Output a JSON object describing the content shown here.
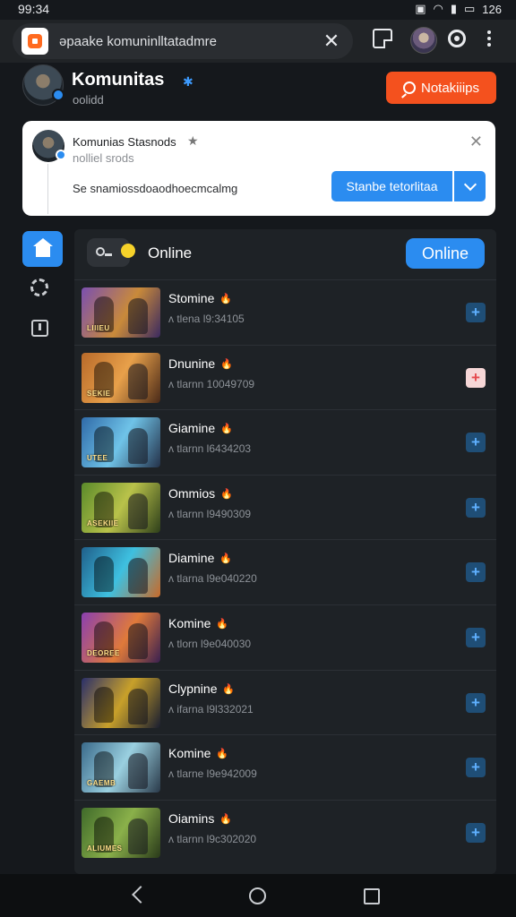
{
  "status_bar": {
    "time": "99:34",
    "battery": "126"
  },
  "browser": {
    "url": "əpaake komuninlltatadmre"
  },
  "community": {
    "title": "Komunitas",
    "subtitle": "oolidd",
    "notify_label": "Notakiiips",
    "accent_color": "#2b8cf0",
    "notify_color": "#f4511e"
  },
  "notification": {
    "title": "Komunias Stasnods",
    "subtitle": "nolliel srods",
    "message": "Se snamiossdoaodhoecmcalmg",
    "action_label": "Stanbe tetorlitaa"
  },
  "panel": {
    "title": "Online",
    "online_button": "Online"
  },
  "rows": [
    {
      "name": "Stomine",
      "meta": "ʌ tlena l9:34105",
      "thumb_label": "LIIIEU",
      "bg": "linear-gradient(120deg,#7a4fb0,#c98a3a 55%,#3b2a60)"
    },
    {
      "name": "Dnunine",
      "meta": "ʌ tlarnn 10049709",
      "thumb_label": "SEKIE",
      "bg": "linear-gradient(120deg,#b86a2a,#e8a04a 50%,#4a2a18)"
    },
    {
      "name": "Giamine",
      "meta": "ʌ tlarnn l6434203",
      "thumb_label": "UTEE",
      "bg": "linear-gradient(120deg,#2f6aa8,#6fc3e8 50%,#24324a)"
    },
    {
      "name": "Ommios",
      "meta": "ʌ tlarnn l9490309",
      "thumb_label": "ASEKIIE",
      "bg": "linear-gradient(120deg,#5a8a2a,#b9c24a 50%,#2e3f1a)"
    },
    {
      "name": "Diamine",
      "meta": "ʌ tlarna l9e040220",
      "thumb_label": "",
      "bg": "linear-gradient(120deg,#1f5f8a,#3ec0e0 50%,#c86a2a)"
    },
    {
      "name": "Komine",
      "meta": "ʌ tlorn l9e040030",
      "thumb_label": "DEOREE",
      "bg": "linear-gradient(120deg,#8a3fb0,#e07a3a 55%,#3a2050)"
    },
    {
      "name": "Clypnine",
      "meta": "ʌ ifarna l9l332021",
      "thumb_label": "",
      "bg": "linear-gradient(120deg,#2a2f6a,#c8a02a 50%,#1a1e30)"
    },
    {
      "name": "Komine",
      "meta": "ʌ tlarne l9e942009",
      "thumb_label": "GAEMB",
      "bg": "linear-gradient(120deg,#3a6a8a,#9ad0e0 50%,#2a3a4a)"
    },
    {
      "name": "Oiamins",
      "meta": "ʌ tlarnn l9c302020",
      "thumb_label": "ALIUMES",
      "bg": "linear-gradient(120deg,#3f6a2a,#8ab04a 50%,#2a3a1a)"
    }
  ],
  "icons": {
    "home": "home-icon",
    "settings": "gear-icon",
    "alerts": "alert-icon"
  }
}
